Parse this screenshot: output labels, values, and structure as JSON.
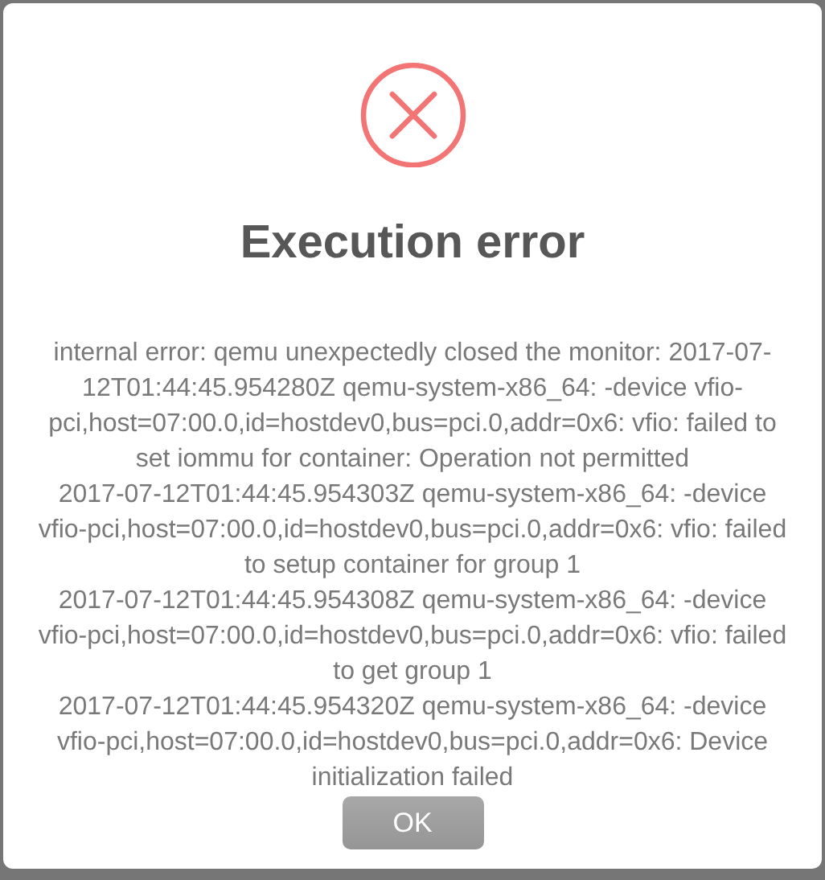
{
  "dialog": {
    "title": "Execution error",
    "message_lines": [
      "internal error: qemu unexpectedly closed the monitor: 2017-07-12T01:44:45.954280Z qemu-system-x86_64: -device vfio-pci,host=07:00.0,id=hostdev0,bus=pci.0,addr=0x6: vfio: failed to set iommu for container: Operation not permitted",
      "2017-07-12T01:44:45.954303Z qemu-system-x86_64: -device vfio-pci,host=07:00.0,id=hostdev0,bus=pci.0,addr=0x6: vfio: failed to setup container for group 1",
      "2017-07-12T01:44:45.954308Z qemu-system-x86_64: -device vfio-pci,host=07:00.0,id=hostdev0,bus=pci.0,addr=0x6: vfio: failed to get group 1",
      "2017-07-12T01:44:45.954320Z qemu-system-x86_64: -device vfio-pci,host=07:00.0,id=hostdev0,bus=pci.0,addr=0x6: Device initialization failed"
    ],
    "buttons": [
      {
        "label": "OK",
        "disabled": true
      }
    ]
  }
}
